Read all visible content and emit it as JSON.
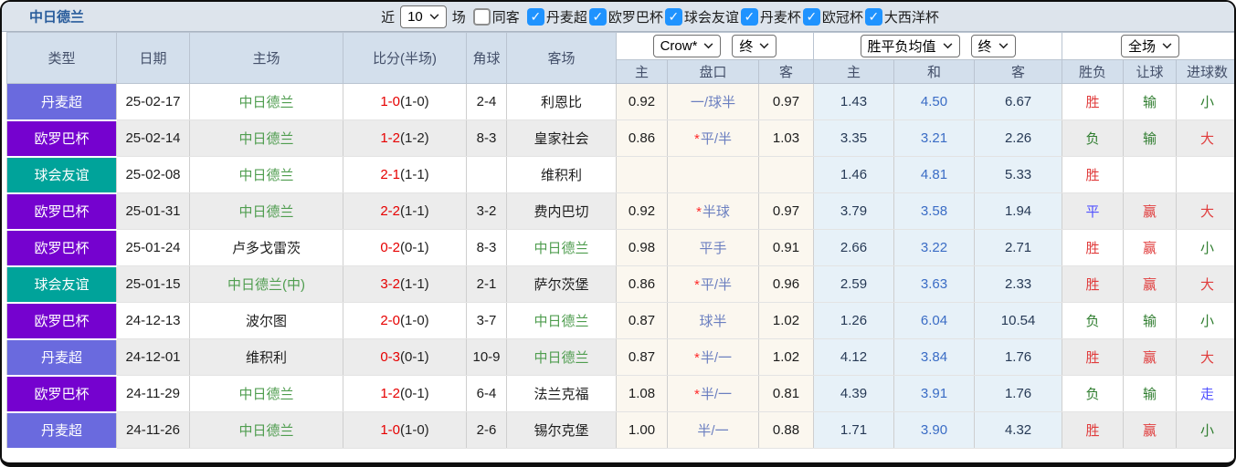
{
  "title": "中日德兰",
  "toolbar": {
    "recent_label": "近",
    "recent_value": "10",
    "games_label": "场",
    "same_venue_label": "同客",
    "same_venue_checked": false,
    "leagues": [
      {
        "label": "丹麦超",
        "checked": true
      },
      {
        "label": "欧罗巴杯",
        "checked": true
      },
      {
        "label": "球会友谊",
        "checked": true
      },
      {
        "label": "丹麦杯",
        "checked": true
      },
      {
        "label": "欧冠杯",
        "checked": true
      },
      {
        "label": "大西洋杯",
        "checked": true
      }
    ]
  },
  "header": {
    "cols": [
      "类型",
      "日期",
      "主场",
      "比分(半场)",
      "角球",
      "客场"
    ],
    "handicap_group": {
      "book": "Crow*",
      "stage": "终",
      "cols": [
        "主",
        "盘口",
        "客"
      ]
    },
    "odds_group": {
      "name": "胜平负均值",
      "stage": "终",
      "cols": [
        "主",
        "和",
        "客"
      ]
    },
    "result_group": {
      "scope": "全场",
      "cols": [
        "胜负",
        "让球",
        "进球数"
      ]
    }
  },
  "league_colors": {
    "丹麦超": "#6a6ade",
    "欧罗巴杯": "#7502cf",
    "球会友谊": "#00a39a"
  },
  "colors": {
    "checkbox_blue": "#1f93ff",
    "title_blue": "#2a5d9c",
    "team_green": "#4f9d4f",
    "score_red": "#e60000",
    "win_red": "#e03c3c",
    "lose_green": "#2f7d2f",
    "draw_blue": "#5050ff",
    "draw_odds_blue": "#3a6cc5",
    "handicap_line_blue": "#6b7fc0",
    "star_red": "#ff2a2a"
  },
  "rows": [
    {
      "league": "丹麦超",
      "date": "25-02-17",
      "home": "中日德兰",
      "home_team": true,
      "score": "1-0",
      "half": "(1-0)",
      "corners": "2-4",
      "away": "利恩比",
      "away_team": false,
      "ah_home": "0.92",
      "ah_star": false,
      "ah_line": "一/球半",
      "ah_away": "0.97",
      "avg_home": "1.43",
      "avg_draw": "4.50",
      "avg_away": "6.67",
      "wdl": "胜",
      "wdl_c": "red",
      "hc_res": "输",
      "hc_c": "green",
      "goal_res": "小",
      "goal_c": "green"
    },
    {
      "league": "欧罗巴杯",
      "date": "25-02-14",
      "home": "中日德兰",
      "home_team": true,
      "score": "1-2",
      "half": "(1-2)",
      "corners": "8-3",
      "away": "皇家社会",
      "away_team": false,
      "ah_home": "0.86",
      "ah_star": true,
      "ah_line": "平/半",
      "ah_away": "1.03",
      "avg_home": "3.35",
      "avg_draw": "3.21",
      "avg_away": "2.26",
      "wdl": "负",
      "wdl_c": "green",
      "hc_res": "输",
      "hc_c": "green",
      "goal_res": "大",
      "goal_c": "red"
    },
    {
      "league": "球会友谊",
      "date": "25-02-08",
      "home": "中日德兰",
      "home_team": true,
      "score": "2-1",
      "half": "(1-1)",
      "corners": "",
      "away": "维积利",
      "away_team": false,
      "ah_home": "",
      "ah_star": false,
      "ah_line": "",
      "ah_away": "",
      "avg_home": "1.46",
      "avg_draw": "4.81",
      "avg_away": "5.33",
      "wdl": "胜",
      "wdl_c": "red",
      "hc_res": "",
      "hc_c": "",
      "goal_res": "",
      "goal_c": ""
    },
    {
      "league": "欧罗巴杯",
      "date": "25-01-31",
      "home": "中日德兰",
      "home_team": true,
      "score": "2-2",
      "half": "(1-1)",
      "corners": "3-2",
      "away": "费内巴切",
      "away_team": false,
      "ah_home": "0.92",
      "ah_star": true,
      "ah_line": "半球",
      "ah_away": "0.97",
      "avg_home": "3.79",
      "avg_draw": "3.58",
      "avg_away": "1.94",
      "wdl": "平",
      "wdl_c": "blue",
      "hc_res": "赢",
      "hc_c": "red",
      "goal_res": "大",
      "goal_c": "red"
    },
    {
      "league": "欧罗巴杯",
      "date": "25-01-24",
      "home": "卢多戈雷茨",
      "home_team": false,
      "score": "0-2",
      "half": "(0-1)",
      "corners": "8-3",
      "away": "中日德兰",
      "away_team": true,
      "ah_home": "0.98",
      "ah_star": false,
      "ah_line": "平手",
      "ah_away": "0.91",
      "avg_home": "2.66",
      "avg_draw": "3.22",
      "avg_away": "2.71",
      "wdl": "胜",
      "wdl_c": "red",
      "hc_res": "赢",
      "hc_c": "red",
      "goal_res": "小",
      "goal_c": "green"
    },
    {
      "league": "球会友谊",
      "date": "25-01-15",
      "home": "中日德兰(中)",
      "home_team": true,
      "score": "3-2",
      "half": "(1-1)",
      "corners": "2-1",
      "away": "萨尔茨堡",
      "away_team": false,
      "ah_home": "0.86",
      "ah_star": true,
      "ah_line": "平/半",
      "ah_away": "0.96",
      "avg_home": "2.59",
      "avg_draw": "3.63",
      "avg_away": "2.33",
      "wdl": "胜",
      "wdl_c": "red",
      "hc_res": "赢",
      "hc_c": "red",
      "goal_res": "大",
      "goal_c": "red"
    },
    {
      "league": "欧罗巴杯",
      "date": "24-12-13",
      "home": "波尔图",
      "home_team": false,
      "score": "2-0",
      "half": "(1-0)",
      "corners": "3-7",
      "away": "中日德兰",
      "away_team": true,
      "ah_home": "0.87",
      "ah_star": false,
      "ah_line": "球半",
      "ah_away": "1.02",
      "avg_home": "1.26",
      "avg_draw": "6.04",
      "avg_away": "10.54",
      "wdl": "负",
      "wdl_c": "green",
      "hc_res": "输",
      "hc_c": "green",
      "goal_res": "小",
      "goal_c": "green"
    },
    {
      "league": "丹麦超",
      "date": "24-12-01",
      "home": "维积利",
      "home_team": false,
      "score": "0-3",
      "half": "(0-1)",
      "corners": "10-9",
      "away": "中日德兰",
      "away_team": true,
      "ah_home": "0.87",
      "ah_star": true,
      "ah_line": "半/一",
      "ah_away": "1.02",
      "avg_home": "4.12",
      "avg_draw": "3.84",
      "avg_away": "1.76",
      "wdl": "胜",
      "wdl_c": "red",
      "hc_res": "赢",
      "hc_c": "red",
      "goal_res": "大",
      "goal_c": "red"
    },
    {
      "league": "欧罗巴杯",
      "date": "24-11-29",
      "home": "中日德兰",
      "home_team": true,
      "score": "1-2",
      "half": "(0-1)",
      "corners": "6-4",
      "away": "法兰克福",
      "away_team": false,
      "ah_home": "1.08",
      "ah_star": true,
      "ah_line": "半/一",
      "ah_away": "0.81",
      "avg_home": "4.39",
      "avg_draw": "3.91",
      "avg_away": "1.76",
      "wdl": "负",
      "wdl_c": "green",
      "hc_res": "输",
      "hc_c": "green",
      "goal_res": "走",
      "goal_c": "blue"
    },
    {
      "league": "丹麦超",
      "date": "24-11-26",
      "home": "中日德兰",
      "home_team": true,
      "score": "1-0",
      "half": "(1-0)",
      "corners": "2-6",
      "away": "锡尔克堡",
      "away_team": false,
      "ah_home": "1.00",
      "ah_star": false,
      "ah_line": "半/一",
      "ah_away": "0.88",
      "avg_home": "1.71",
      "avg_draw": "3.90",
      "avg_away": "4.32",
      "wdl": "胜",
      "wdl_c": "red",
      "hc_res": "赢",
      "hc_c": "red",
      "goal_res": "小",
      "goal_c": "green"
    }
  ]
}
